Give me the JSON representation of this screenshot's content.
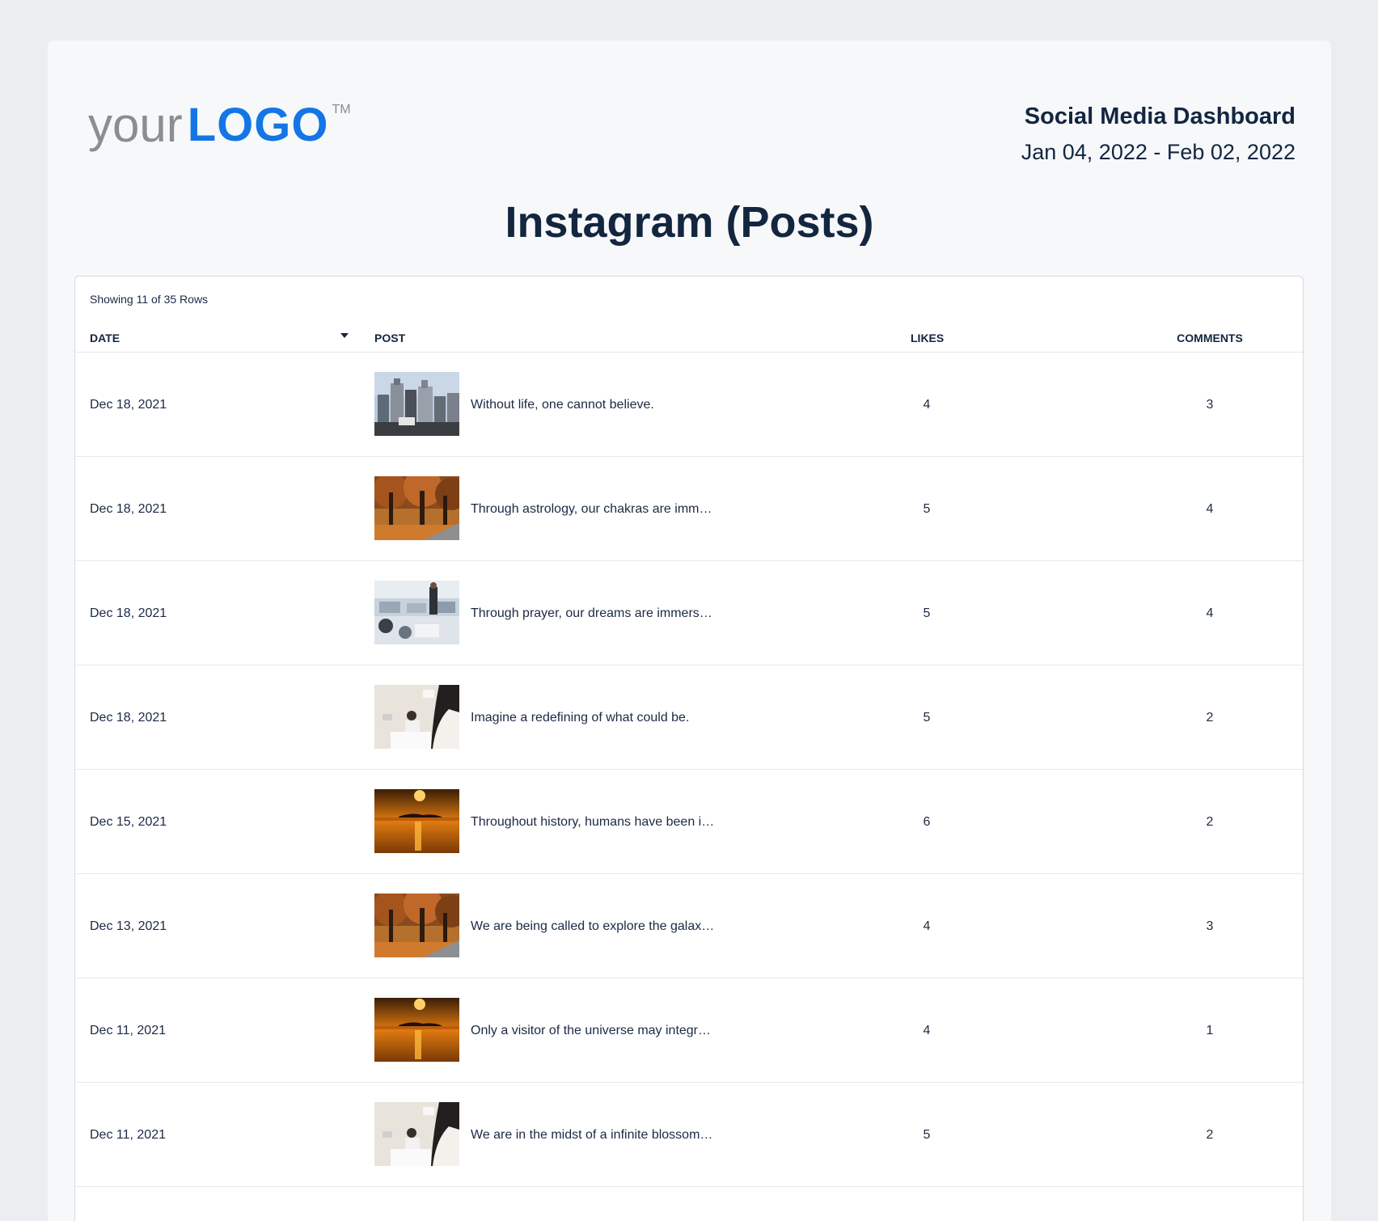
{
  "header": {
    "logo_prefix": "your",
    "logo_main": "LOGO",
    "logo_tm": "TM",
    "title": "Social Media Dashboard",
    "date_range": "Jan 04, 2022 - Feb 02, 2022"
  },
  "page_title": "Instagram (Posts)",
  "table": {
    "showing": "Showing 11 of 35 Rows",
    "columns": {
      "date": "DATE",
      "post": "POST",
      "likes": "LIKES",
      "comments": "COMMENTS"
    },
    "rows": [
      {
        "date": "Dec 18, 2021",
        "thumb": "city-buildings-image",
        "text": "Without life, one cannot believe.",
        "likes": "4",
        "comments": "3"
      },
      {
        "date": "Dec 18, 2021",
        "thumb": "autumn-trees-image",
        "text": "Through astrology, our chakras are imm…",
        "likes": "5",
        "comments": "4"
      },
      {
        "date": "Dec 18, 2021",
        "thumb": "office-meeting-image",
        "text": "Through prayer, our dreams are immers…",
        "likes": "5",
        "comments": "4"
      },
      {
        "date": "Dec 18, 2021",
        "thumb": "office-desk-image",
        "text": "Imagine a redefining of what could be.",
        "likes": "5",
        "comments": "2"
      },
      {
        "date": "Dec 15, 2021",
        "thumb": "sunset-water-image",
        "text": "Throughout history, humans have been i…",
        "likes": "6",
        "comments": "2"
      },
      {
        "date": "Dec 13, 2021",
        "thumb": "autumn-trees-image",
        "text": "We are being called to explore the galax…",
        "likes": "4",
        "comments": "3"
      },
      {
        "date": "Dec 11, 2021",
        "thumb": "sunset-water-image",
        "text": "Only a visitor of the universe may integr…",
        "likes": "4",
        "comments": "1"
      },
      {
        "date": "Dec 11, 2021",
        "thumb": "office-desk-image",
        "text": "We are in the midst of a infinite blossom…",
        "likes": "5",
        "comments": "2"
      }
    ]
  },
  "colors": {
    "logo_blue": "#1476e6",
    "logo_gray": "#8a8d92",
    "heading": "#132640"
  }
}
